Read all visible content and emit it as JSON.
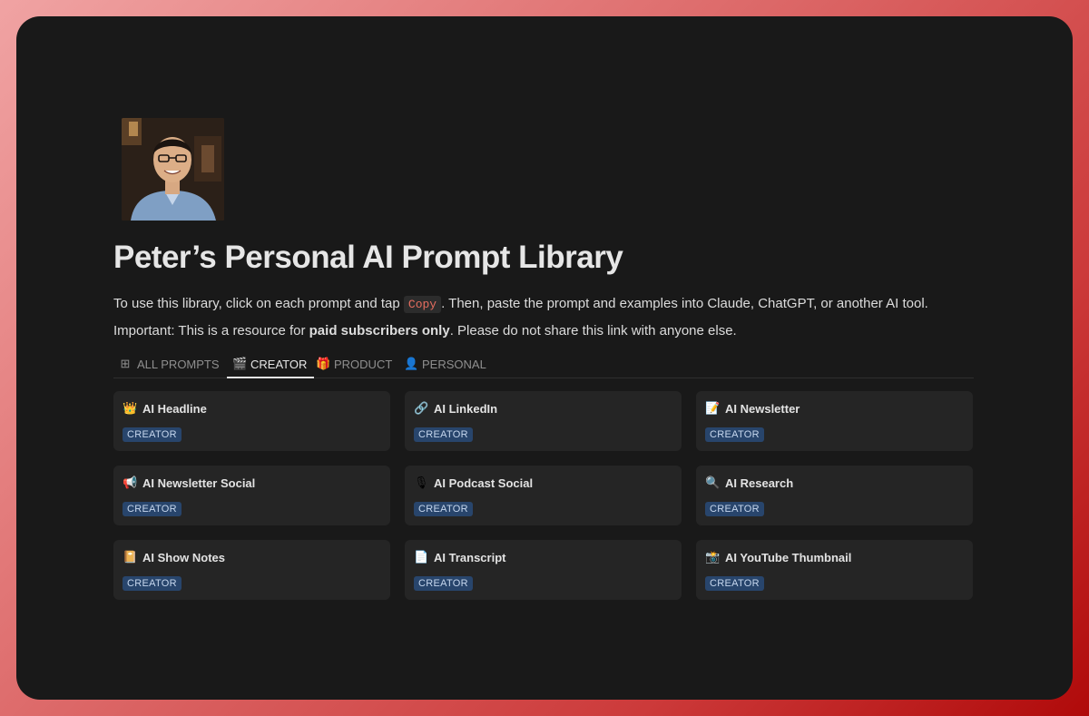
{
  "page": {
    "title": "Peter’s Personal AI Prompt Library",
    "intro": {
      "before": "To use this library, click on each prompt and tap",
      "code": "Copy",
      "after": ". Then, paste the prompt and examples into Claude, ChatGPT, or another AI tool."
    },
    "notice": {
      "before": "Important: This is a resource for ",
      "bold": "paid subscribers only",
      "after": ". Please do not share this link with anyone else."
    }
  },
  "tabs": [
    {
      "label": "ALL PROMPTS",
      "icon": "⊞",
      "icon_name": "grid-icon"
    },
    {
      "label": "CREATOR",
      "icon": "🎬",
      "icon_name": "clapper-icon"
    },
    {
      "label": "PRODUCT",
      "icon": "🎁",
      "icon_name": "gift-icon"
    },
    {
      "label": "PERSONAL",
      "icon": "👤",
      "icon_name": "person-icon"
    }
  ],
  "active_tab": "CREATOR",
  "cards": [
    {
      "name": "AI Headline",
      "emoji": "👑",
      "icon_name": "crown-icon",
      "tag": "CREATOR"
    },
    {
      "name": "AI LinkedIn",
      "emoji": "🔗",
      "icon_name": "link-icon",
      "tag": "CREATOR"
    },
    {
      "name": "AI Newsletter",
      "emoji": "📝",
      "icon_name": "memo-icon",
      "tag": "CREATOR"
    },
    {
      "name": "AI Newsletter Social",
      "emoji": "📢",
      "icon_name": "megaphone-icon",
      "tag": "CREATOR"
    },
    {
      "name": "AI Podcast Social",
      "emoji": "🎙",
      "icon_name": "microphone-icon",
      "tag": "CREATOR"
    },
    {
      "name": "AI Research",
      "emoji": "🔍",
      "icon_name": "magnifier-icon",
      "tag": "CREATOR"
    },
    {
      "name": "AI Show Notes",
      "emoji": "📔",
      "icon_name": "notebook-icon",
      "tag": "CREATOR"
    },
    {
      "name": "AI Transcript",
      "emoji": "📄",
      "icon_name": "document-icon",
      "tag": "CREATOR"
    },
    {
      "name": "AI YouTube Thumbnail",
      "emoji": "📸",
      "icon_name": "camera-icon",
      "tag": "CREATOR"
    }
  ],
  "colors": {
    "page_bg": "#191919",
    "card_bg": "#252525",
    "badge_bg": "#28456c",
    "badge_text": "#c6d7ee",
    "code_text": "#e56d5f"
  }
}
